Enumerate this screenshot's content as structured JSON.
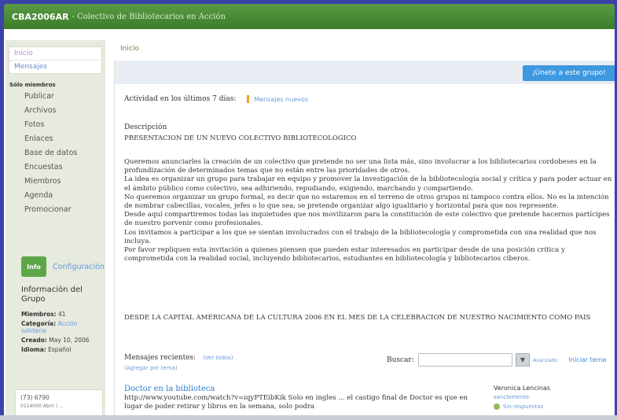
{
  "header": {
    "group_id": "CBA2006AR",
    "title": "- Colectivo de Bibliotecarios en Acción"
  },
  "nav": {
    "inicio": "Inicio",
    "mensajes": "Mensajes"
  },
  "sidebar": {
    "members_heading": "Sólo miembros",
    "items": [
      {
        "label": "Publicar"
      },
      {
        "label": "Archivos"
      },
      {
        "label": "Fotos"
      },
      {
        "label": "Enlaces"
      },
      {
        "label": "Base de datos"
      },
      {
        "label": "Encuestas"
      },
      {
        "label": "Miembros"
      },
      {
        "label": "Agenda"
      },
      {
        "label": "Promocionar"
      }
    ],
    "info_badge": "Info",
    "config_link": "Configuración",
    "group_info_title": "Información del Grupo",
    "group_info": {
      "members_label": "Miembros:",
      "members_value": "41",
      "category_label": "Categoría:",
      "category_value": "Acción solidaria",
      "created_label": "Creado:",
      "created_value": "May 10, 2006",
      "language_label": "Idioma:",
      "language_value": "Español"
    },
    "bottom_line1": "(73) 6790",
    "bottom_line2": "0114000 Abrir | ..."
  },
  "breadcrumb": "Inicio",
  "join_button": "¡Únete a este grupo!",
  "activity": {
    "label": "Actividad en los últimos 7 días:",
    "new_messages": "Mensajes nuevos"
  },
  "description": {
    "label": "Descripción",
    "heading": "PRESENTACION DE UN NUEVO COLECTIVO BIBLIOTECOLOGICO",
    "body": "Queremos anunciarles la creación de un colectivo que pretende no ser una lista más, sino involucrar a los bibliotecarios cordobeses en la profundización de determinados temas que no están entre las prioridades de otros.\nLa idea es organizar un grupo para trabajar en equipo y promover la investigación de la bibliotecología social y crítica y para poder actuar en el ámbito público como colectivo, sea adhiriendo, repudiando, exigiendo, marchando y compartiendo.\nNo queremos organizar un grupo formal, es decir que no estaremos en el terreno de otros grupos ni tampoco contra ellos. No es la intención de nombrar cabecillas, vocales, jefes o lo que sea; se pretende organizar algo igualitario y horizontal para que nos represente.\nDesde aquí compartiremos todas las inquietudes que nos movilizaron para la constitución de este colectivo que pretende hacernos partícipes de nuestro porvenir como profesionales.\nLos invitamos a participar a los que se sientan involucrados con el trabajo de la bibliotecología y comprometida con una realidad que nos incluya.\nPor favor repliquen esta invitación a quienes piensen que pueden estar interesados en participar desde de una posición crítica y comprometida con la realidad social, incluyendo bibliotecarios, estudiantes en bibliotecología y bibliotecarios ciberos.",
    "closing": "DESDE LA CAPITAL AMERICANA DE LA CULTURA 2006 EN EL MES DE LA CELEBRACION DE NUESTRO NACIMIENTO COMO PAIS"
  },
  "recent": {
    "label": "Mensajes recientes:",
    "see_all": "(Ver todos)",
    "subscribe": "(Agregar por tema)"
  },
  "search": {
    "label": "Buscar:",
    "placeholder": "",
    "button": "▼",
    "advanced": "Avanzado",
    "new_topic": "Iniciar tema"
  },
  "post": {
    "title": "Doctor en la biblioteca",
    "body": "http://www.youtube.com/watch?v=iqyPTEibKik Solo en ingles ... el castigo final de Doctor es que en lugar de poder retirar y libros en la semana, solo podra",
    "author": "Veronica Lencinas",
    "date": "sanclemente",
    "reply": "Sin respuestas"
  }
}
